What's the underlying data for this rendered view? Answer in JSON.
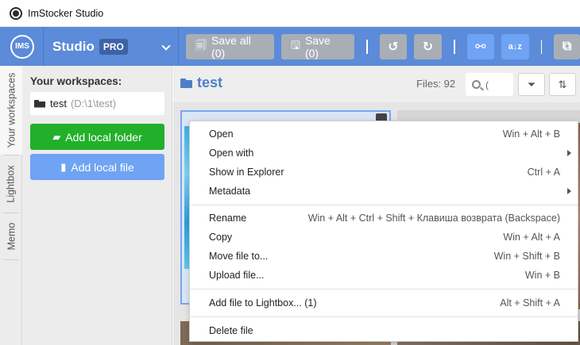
{
  "window": {
    "title": "ImStocker Studio"
  },
  "brand": {
    "logo_text": "IMS",
    "name": "Studio",
    "badge": "PRO"
  },
  "toolbar": {
    "save_all_label": "Save all (0)",
    "save_label": "Save (0)",
    "icons": [
      "undo-icon",
      "redo-icon",
      "binoculars-icon",
      "sort-az-icon",
      "copy-icon"
    ]
  },
  "vtabs": [
    "Your workspaces",
    "Lightbox",
    "Memo"
  ],
  "sidebar": {
    "heading": "Your workspaces:",
    "workspace": {
      "name": "test",
      "path": "(D:\\1\\test)"
    },
    "add_folder_label": "Add local folder",
    "add_file_label": "Add local file"
  },
  "main": {
    "folder_title": "test",
    "files_count": "Files: 92",
    "search_value": "("
  },
  "context_menu": {
    "items": [
      {
        "label": "Open",
        "shortcut": "Win + Alt + B"
      },
      {
        "label": "Open with",
        "shortcut": ""
      },
      {
        "label": "Show in Explorer",
        "shortcut": "Ctrl + A"
      },
      {
        "label": "Metadata",
        "shortcut": ""
      },
      {
        "label": "Rename",
        "shortcut": "Win + Alt + Ctrl + Shift + Клавиша возврата (Backspace)"
      },
      {
        "label": "Copy",
        "shortcut": "Win + Alt + A"
      },
      {
        "label": "Move file to...",
        "shortcut": "Win + Shift + B"
      },
      {
        "label": "Upload file...",
        "shortcut": "Win + B"
      },
      {
        "label": "Add file to Lightbox... (1)",
        "shortcut": "Alt + Shift + A"
      },
      {
        "label": "Delete file",
        "shortcut": ""
      }
    ]
  },
  "colors": {
    "toolbar": "#5b8bd9",
    "accent_blue": "#6fa3f3",
    "green": "#22b02b",
    "title_blue": "#4f7fc8"
  }
}
